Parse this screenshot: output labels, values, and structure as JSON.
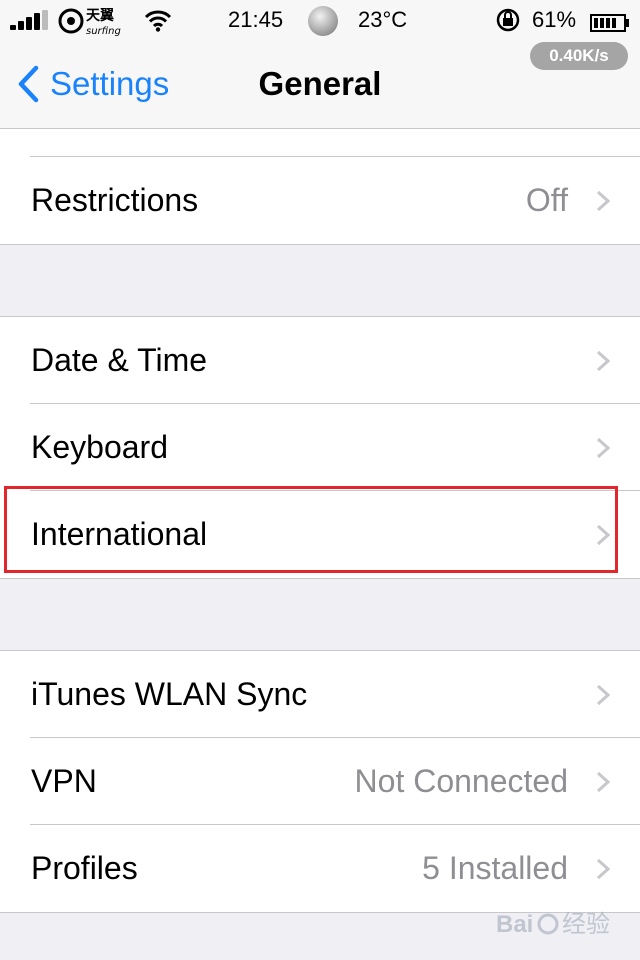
{
  "status_bar": {
    "carrier_name": "天翼",
    "carrier_sub": "surfing",
    "time": "21:45",
    "temperature": "23°C",
    "battery_percent": "61%",
    "network_speed": "0.40K/s",
    "icons": [
      "signal-icon",
      "carrier-logo",
      "wifi-icon",
      "weather-cloud-icon",
      "rotation-lock-icon",
      "battery-icon"
    ]
  },
  "nav": {
    "back_label": "Settings",
    "title": "General"
  },
  "groups": [
    {
      "rows": [
        {
          "label": "Restrictions",
          "value": "Off"
        }
      ]
    },
    {
      "rows": [
        {
          "label": "Date & Time",
          "value": ""
        },
        {
          "label": "Keyboard",
          "value": ""
        },
        {
          "label": "International",
          "value": ""
        }
      ]
    },
    {
      "rows": [
        {
          "label": "iTunes WLAN Sync",
          "value": ""
        },
        {
          "label": "VPN",
          "value": "Not Connected"
        },
        {
          "label": "Profiles",
          "value": "5 Installed"
        }
      ]
    }
  ],
  "colors": {
    "accent": "#1a82fb",
    "highlight_box": "#e3262b",
    "background": "#efeff4",
    "value_text": "#8e8e93"
  }
}
